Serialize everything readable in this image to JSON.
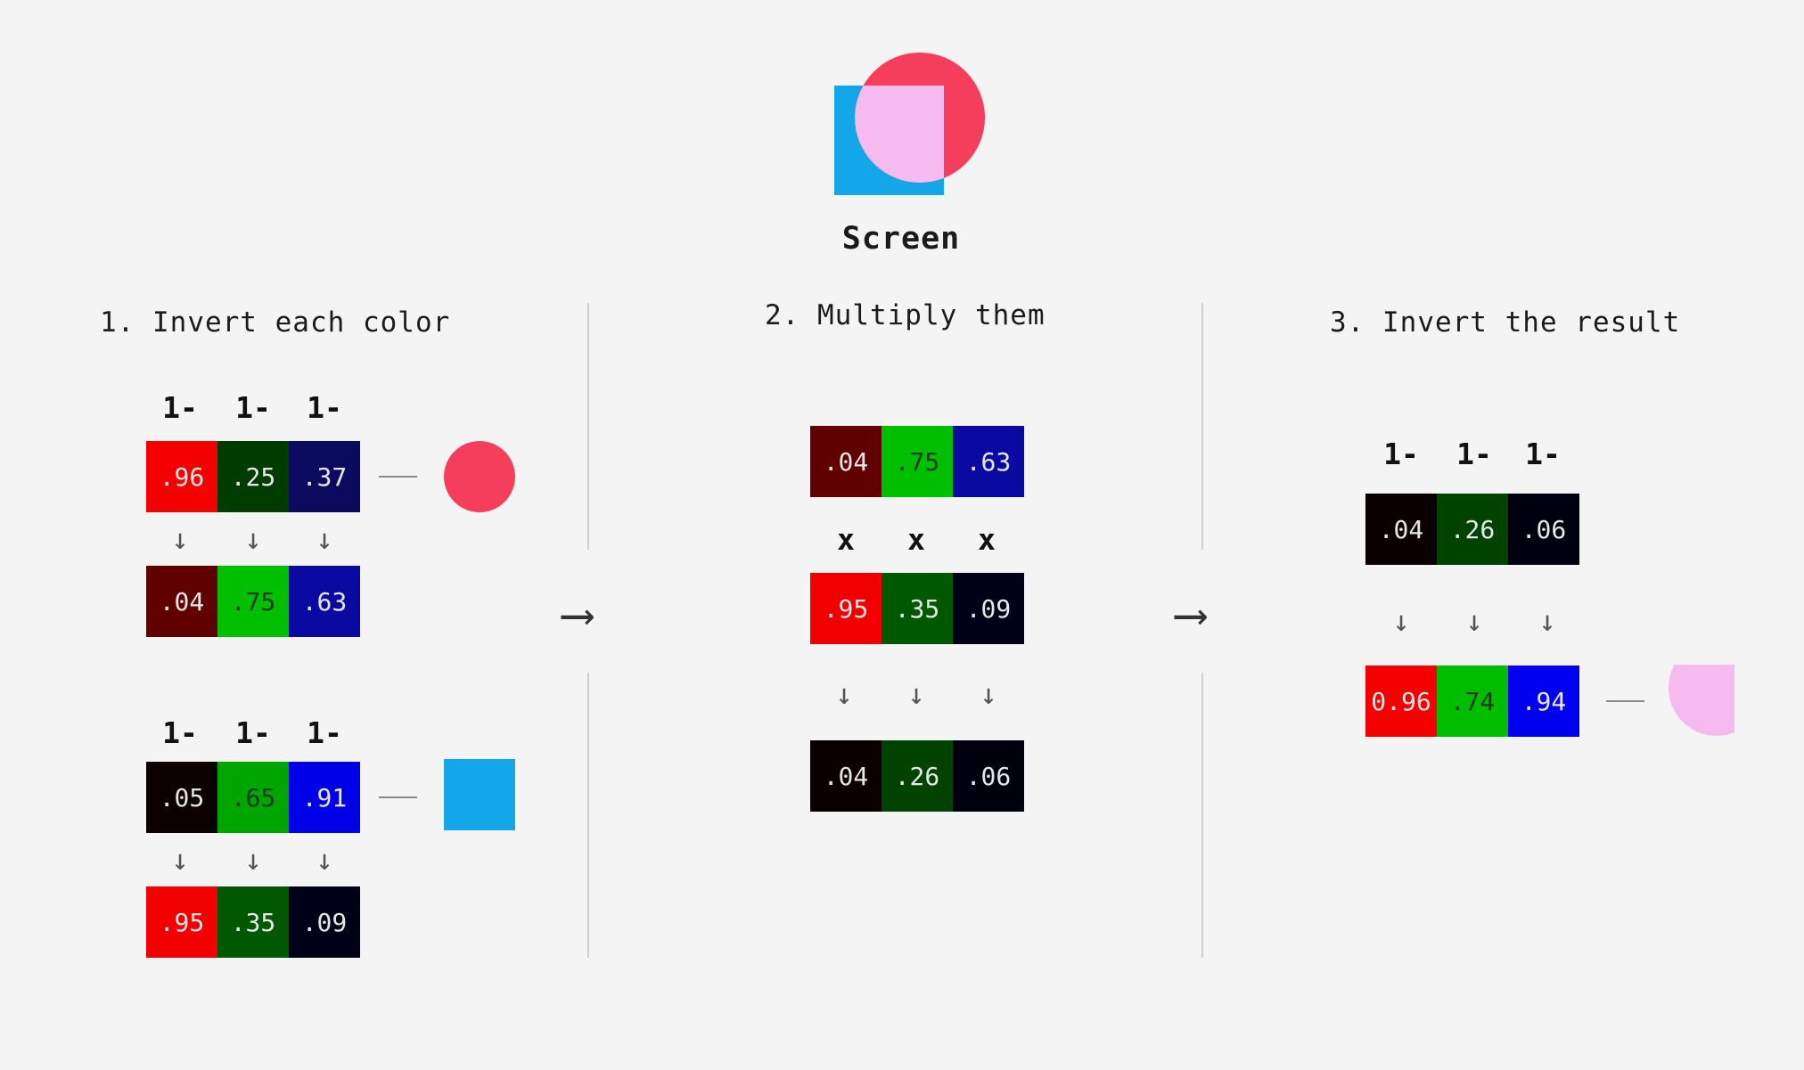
{
  "title": "Screen",
  "colors": {
    "circle": "#f53d5c",
    "square": "#13a6e8",
    "overlap": "#f5bbef",
    "background": "#f4f4f4"
  },
  "steps": [
    {
      "label": "1. Invert each color"
    },
    {
      "label": "2. Multiply them"
    },
    {
      "label": "3. Invert the result"
    }
  ],
  "ops": {
    "one_minus": "1-",
    "times": "x",
    "down": "↓",
    "right": "⟶"
  },
  "step1": {
    "circle_original": [
      {
        "value": ".96",
        "color": "#f50000"
      },
      {
        "value": ".25",
        "color": "#003c00"
      },
      {
        "value": ".37",
        "color": "#0a0a5e"
      }
    ],
    "circle_inverted": [
      {
        "value": ".04",
        "color": "#600000"
      },
      {
        "value": ".75",
        "color": "#00bf00"
      },
      {
        "value": ".63",
        "color": "#0a0aa2"
      }
    ],
    "square_original": [
      {
        "value": ".05",
        "color": "#0d0000"
      },
      {
        "value": ".65",
        "color": "#00a600"
      },
      {
        "value": ".91",
        "color": "#0000e8"
      }
    ],
    "square_inverted": [
      {
        "value": ".95",
        "color": "#f20000"
      },
      {
        "value": ".35",
        "color": "#005900"
      },
      {
        "value": ".09",
        "color": "#000016"
      }
    ]
  },
  "step2": {
    "top": [
      {
        "value": ".04",
        "color": "#600000"
      },
      {
        "value": ".75",
        "color": "#00bf00"
      },
      {
        "value": ".63",
        "color": "#0a0aa2"
      }
    ],
    "middle": [
      {
        "value": ".95",
        "color": "#f20000"
      },
      {
        "value": ".35",
        "color": "#005900"
      },
      {
        "value": ".09",
        "color": "#000016"
      }
    ],
    "product": [
      {
        "value": ".04",
        "color": "#0a0000"
      },
      {
        "value": ".26",
        "color": "#004200"
      },
      {
        "value": ".06",
        "color": "#00000f"
      }
    ]
  },
  "step3": {
    "top": [
      {
        "value": ".04",
        "color": "#0a0000"
      },
      {
        "value": ".26",
        "color": "#004200"
      },
      {
        "value": ".06",
        "color": "#00000f"
      }
    ],
    "result": [
      {
        "value": "0.96",
        "color": "#f50000"
      },
      {
        "value": ".74",
        "color": "#00bd00"
      },
      {
        "value": ".94",
        "color": "#0000f0"
      }
    ]
  }
}
